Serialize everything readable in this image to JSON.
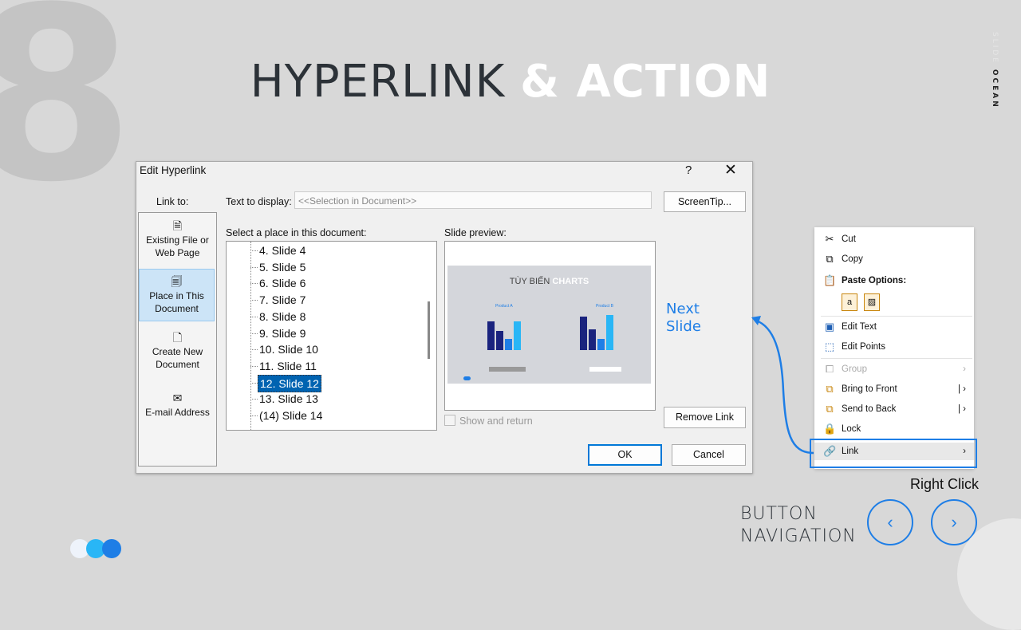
{
  "slide": {
    "number": "8",
    "title_part1": "HYPERLINK",
    "title_part2": "& ACTION",
    "brand_a": "SLIDE",
    "brand_b": "OCEAN",
    "next_slide_line1": "Next",
    "next_slide_line2": "Slide",
    "right_click": "Right Click",
    "button_nav_line1": "BUTTON",
    "button_nav_line2": "NAVIGATION",
    "prev_icon": "chevron-left-icon",
    "next_icon": "chevron-right-icon",
    "accent_color": "#1e7ee6"
  },
  "dialog": {
    "title": "Edit Hyperlink",
    "help": "?",
    "close": "✕",
    "link_to_label": "Link to:",
    "link_options": [
      {
        "line1": "Existing File or",
        "line2": "Web Page",
        "icon": "file-icon"
      },
      {
        "line1": "Place in This",
        "line2": "Document",
        "icon": "place-icon",
        "selected": true
      },
      {
        "line1": "Create New",
        "line2": "Document",
        "icon": "new-doc-icon"
      },
      {
        "line1": "E-mail Address",
        "line2": "",
        "icon": "email-icon"
      }
    ],
    "text_to_display_label": "Text to display:",
    "text_to_display_value": "<<Selection in Document>>",
    "screentip_label": "ScreenTip...",
    "select_place_label": "Select a place in this document:",
    "slides": [
      "4. Slide 4",
      "5. Slide 5",
      "6. Slide 6",
      "7. Slide 7",
      "8. Slide 8",
      "9. Slide 9",
      "10. Slide 10",
      "11. Slide 11",
      "12. Slide 12",
      "13. Slide 13",
      "(14) Slide 14"
    ],
    "selected_slide": "12. Slide 12",
    "slide_preview_label": "Slide preview:",
    "preview_title": "TÙY BIẾN",
    "preview_title_bold": "CHARTS",
    "preview_label_a": "Product A",
    "preview_label_b": "Product B",
    "show_and_return_label": "Show and return",
    "remove_link_label": "Remove Link",
    "ok_label": "OK",
    "cancel_label": "Cancel"
  },
  "context_menu": {
    "items": [
      {
        "label": "Cut",
        "icon": "scissors-icon"
      },
      {
        "label": "Copy",
        "icon": "copy-icon"
      },
      {
        "label": "Paste Options:",
        "icon": "paste-icon"
      },
      {
        "label": "Edit Text",
        "icon": "edit-text-icon"
      },
      {
        "label": "Edit Points",
        "icon": "edit-points-icon"
      },
      {
        "label": "Group",
        "icon": "group-icon",
        "disabled": true
      },
      {
        "label": "Bring to Front",
        "icon": "bring-front-icon"
      },
      {
        "label": "Send to Back",
        "icon": "send-back-icon"
      },
      {
        "label": "Lock",
        "icon": "lock-icon"
      },
      {
        "label": "Link",
        "icon": "link-icon"
      }
    ]
  }
}
